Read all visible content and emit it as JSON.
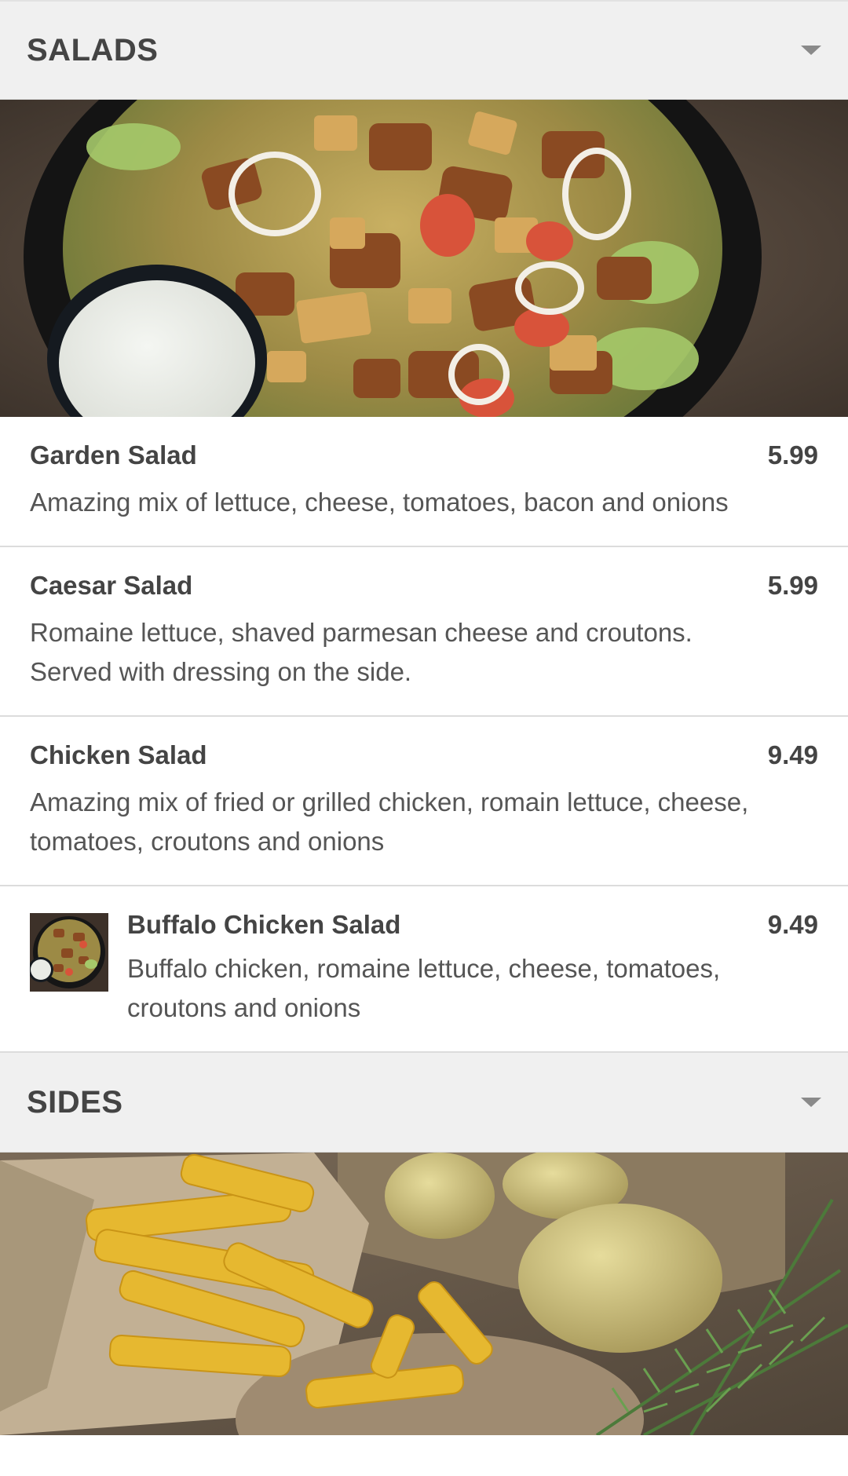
{
  "sections": [
    {
      "title": "SALADS",
      "items": [
        {
          "name": "Garden Salad",
          "price": "5.99",
          "description": "Amazing mix of lettuce, cheese, tomatoes, bacon and onions"
        },
        {
          "name": "Caesar Salad",
          "price": "5.99",
          "description": "Romaine lettuce, shaved parmesan cheese and croutons. Served with dressing on the side."
        },
        {
          "name": "Chicken Salad",
          "price": "9.49",
          "description": "Amazing mix of fried or grilled chicken, romain lettuce, cheese, tomatoes, croutons and onions"
        },
        {
          "name": "Buffalo Chicken Salad",
          "price": "9.49",
          "description": "Buffalo chicken, romaine lettuce, cheese, tomatoes, croutons and onions"
        }
      ]
    },
    {
      "title": "SIDES"
    }
  ],
  "icons": {
    "expand": "chevron-down-icon"
  },
  "colors": {
    "header_bg": "#f0f0f0",
    "text": "#444444",
    "divider": "#dcdcdc"
  }
}
